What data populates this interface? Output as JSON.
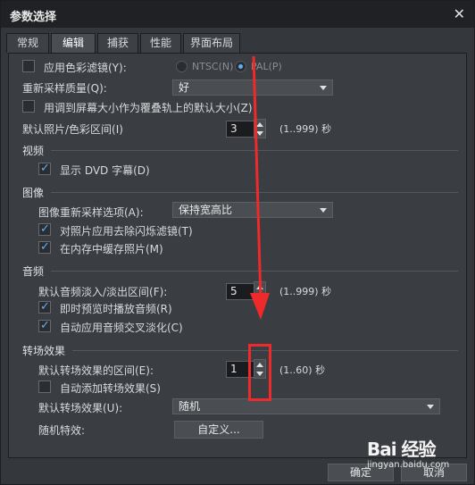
{
  "window": {
    "title": "参数选择",
    "close_glyph": "✕"
  },
  "tabs": [
    {
      "label": "常规"
    },
    {
      "label": "编辑",
      "active": true
    },
    {
      "label": "捕获"
    },
    {
      "label": "性能"
    },
    {
      "label": "界面布局"
    }
  ],
  "general": {
    "color_filter_label": "应用色彩滤镜(Y):",
    "color_filter_checked": false,
    "ntsc_label": "NTSC(N)",
    "pal_label": "PAL(P)",
    "resample_label": "重新采样质量(Q):",
    "resample_value": "好",
    "fit_overlay_label": "用调到屏幕大小作为覆叠轨上的默认大小(Z)",
    "fit_overlay_checked": false,
    "photo_interval_label": "默认照片/色彩区间(I)",
    "photo_interval_value": "3",
    "photo_interval_range": "(1..999) 秒"
  },
  "video": {
    "section": "视频",
    "dvd_subtitle_label": "显示 DVD 字幕(D)",
    "dvd_subtitle_checked": true
  },
  "image": {
    "section": "图像",
    "resample_option_label": "图像重新采样选项(A):",
    "resample_option_value": "保持宽高比",
    "deflicker_label": "对照片应用去除闪烁滤镜(T)",
    "deflicker_checked": true,
    "cache_label": "在内存中缓存照片(M)",
    "cache_checked": true
  },
  "audio": {
    "section": "音频",
    "fade_label": "默认音频淡入/淡出区间(F):",
    "fade_value": "5",
    "fade_range": "(1..999) 秒",
    "preview_label": "即时预览时播放音频(R)",
    "preview_checked": true,
    "crossfade_label": "自动应用音频交叉淡化(C)",
    "crossfade_checked": true
  },
  "transition": {
    "section": "转场效果",
    "duration_label": "默认转场效果的区间(E):",
    "duration_value": "1",
    "duration_range": "(1..60) 秒",
    "auto_add_label": "自动添加转场效果(S)",
    "auto_add_checked": false,
    "default_effect_label": "默认转场效果(U):",
    "default_effect_value": "随机",
    "random_label": "随机特效:",
    "customize_label": "自定义..."
  },
  "footer": {
    "ok_label": "确定",
    "cancel_label": "取消"
  },
  "watermark": {
    "logo": "Bai 经验",
    "url": "jingyan.baidu.com"
  },
  "colors": {
    "accent": "#5ab0ff",
    "annotation": "#ee2a2a",
    "panel": "#3a3d42",
    "titlebar": "#1f2124"
  }
}
